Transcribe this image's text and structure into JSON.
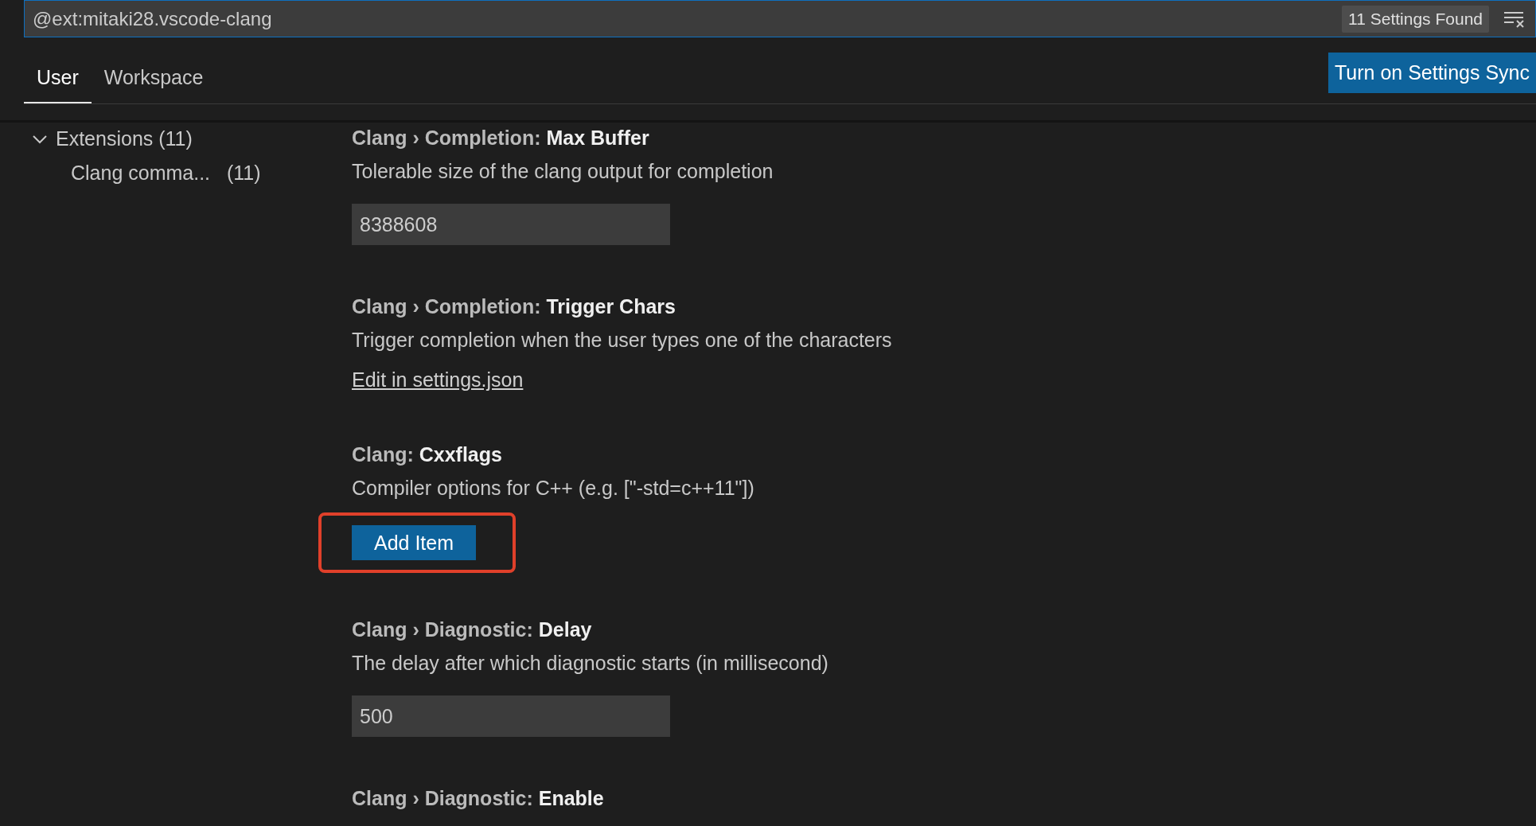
{
  "search": {
    "value": "@ext:mitaki28.vscode-clang",
    "count": "11 Settings Found"
  },
  "tabs": [
    {
      "label": "User",
      "selected": true
    },
    {
      "label": "Workspace",
      "selected": false
    }
  ],
  "sync_button": "Turn on Settings Sync",
  "sidebar": {
    "items": [
      {
        "label": "Extensions",
        "count": "(11)",
        "expanded": true,
        "children": [
          {
            "label": "Clang comma...",
            "count": "(11)"
          }
        ]
      }
    ]
  },
  "settings": [
    {
      "category": "Clang › Completion:",
      "name": "Max Buffer",
      "description": "Tolerable size of the clang output for completion",
      "kind": "input",
      "value": "8388608"
    },
    {
      "category": "Clang › Completion:",
      "name": "Trigger Chars",
      "description": "Trigger completion when the user types one of the characters",
      "kind": "link",
      "value": "Edit in settings.json"
    },
    {
      "category": "Clang:",
      "name": "Cxxflags",
      "description": "Compiler options for C++ (e.g. [\"-std=c++11\"])",
      "kind": "array",
      "value": "Add Item",
      "highlighted": true
    },
    {
      "category": "Clang › Diagnostic:",
      "name": "Delay",
      "description": "The delay after which diagnostic starts (in millisecond)",
      "kind": "input",
      "value": "500"
    },
    {
      "category": "Clang › Diagnostic:",
      "name": "Enable",
      "kind": "none"
    }
  ]
}
